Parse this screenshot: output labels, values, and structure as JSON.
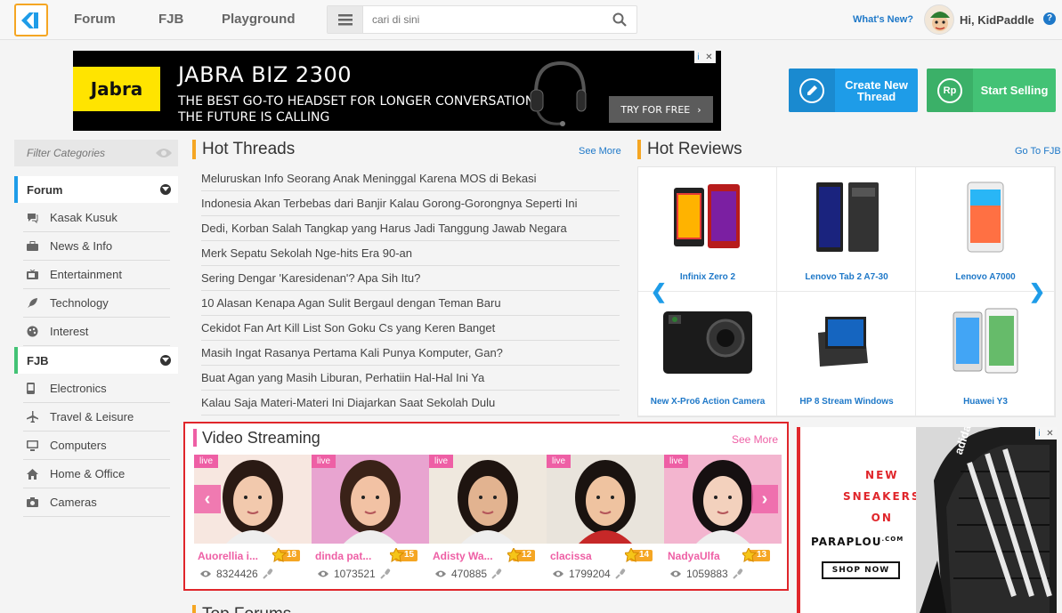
{
  "nav": {
    "links": [
      "Forum",
      "FJB",
      "Playground"
    ],
    "search_placeholder": "cari di sini",
    "whats_new": "What's New?",
    "greeting": "Hi, KidPaddle",
    "help": "?"
  },
  "banner_ad": {
    "brand": "Jabra",
    "title": "JABRA BIZ 2300",
    "line1": "THE BEST GO-TO HEADSET FOR LONGER CONVERSATION.",
    "line2": "THE FUTURE IS CALLING",
    "cta": "TRY FOR FREE"
  },
  "actions": {
    "create": "Create New Thread",
    "sell": "Start Selling",
    "sell_icon_text": "Rp"
  },
  "sidebar": {
    "filter_placeholder": "Filter Categories",
    "forum_header": "Forum",
    "forum_items": [
      {
        "label": "Kasak Kusuk",
        "icon": "chat-icon"
      },
      {
        "label": "News & Info",
        "icon": "briefcase-icon"
      },
      {
        "label": "Entertainment",
        "icon": "tv-icon"
      },
      {
        "label": "Technology",
        "icon": "rocket-icon"
      },
      {
        "label": "Interest",
        "icon": "palette-icon"
      }
    ],
    "fjb_header": "FJB",
    "fjb_items": [
      {
        "label": "Electronics",
        "icon": "phone-icon"
      },
      {
        "label": "Travel & Leisure",
        "icon": "plane-icon"
      },
      {
        "label": "Computers",
        "icon": "monitor-icon"
      },
      {
        "label": "Home & Office",
        "icon": "house-icon"
      },
      {
        "label": "Cameras",
        "icon": "camera-icon"
      }
    ]
  },
  "hot_threads": {
    "title": "Hot Threads",
    "see_more": "See More",
    "items": [
      "Meluruskan Info Seorang Anak Meninggal Karena MOS di Bekasi",
      "Indonesia Akan Terbebas dari Banjir Kalau Gorong-Gorongnya Seperti Ini",
      "Dedi, Korban Salah Tangkap yang Harus Jadi Tanggung Jawab Negara",
      "Merk Sepatu Sekolah Nge-hits Era 90-an",
      "Sering Dengar 'Karesidenan'? Apa Sih Itu?",
      "10 Alasan Kenapa Agan Sulit Bergaul dengan Teman Baru",
      "Cekidot Fan Art Kill List Son Goku Cs yang Keren Banget",
      "Masih Ingat Rasanya Pertama Kali Punya Komputer, Gan?",
      "Buat Agan yang Masih Liburan, Perhatiin Hal-Hal Ini Ya",
      "Kalau Saja Materi-Materi Ini Diajarkan Saat Sekolah Dulu"
    ]
  },
  "hot_reviews": {
    "title": "Hot Reviews",
    "go_to": "Go To FJB",
    "items": [
      {
        "name": "Infinix Zero 2"
      },
      {
        "name": "Lenovo Tab 2 A7-30"
      },
      {
        "name": "Lenovo A7000"
      },
      {
        "name": "New X-Pro6 Action Camera"
      },
      {
        "name": "HP 8 Stream Windows"
      },
      {
        "name": "Huawei Y3"
      }
    ]
  },
  "video_streaming": {
    "title": "Video Streaming",
    "see_more": "See More",
    "live_label": "live",
    "streams": [
      {
        "name": "Auorellia i...",
        "level": "18",
        "views": "8324426"
      },
      {
        "name": "dinda pat...",
        "level": "15",
        "views": "1073521"
      },
      {
        "name": "Adisty Wa...",
        "level": "12",
        "views": "470885"
      },
      {
        "name": "clacissa",
        "level": "14",
        "views": "1799204"
      },
      {
        "name": "NadyaUlfa",
        "level": "13",
        "views": "1059883"
      }
    ]
  },
  "side_ad": {
    "line1": "NEW",
    "line2": "SNEAKERS",
    "line3": "ON",
    "brand": "PARAPLOU",
    "brand_suffix": ".COM",
    "cta": "SHOP NOW",
    "shoe_brand": "adidas"
  },
  "top_forums": {
    "title": "Top Forums"
  }
}
